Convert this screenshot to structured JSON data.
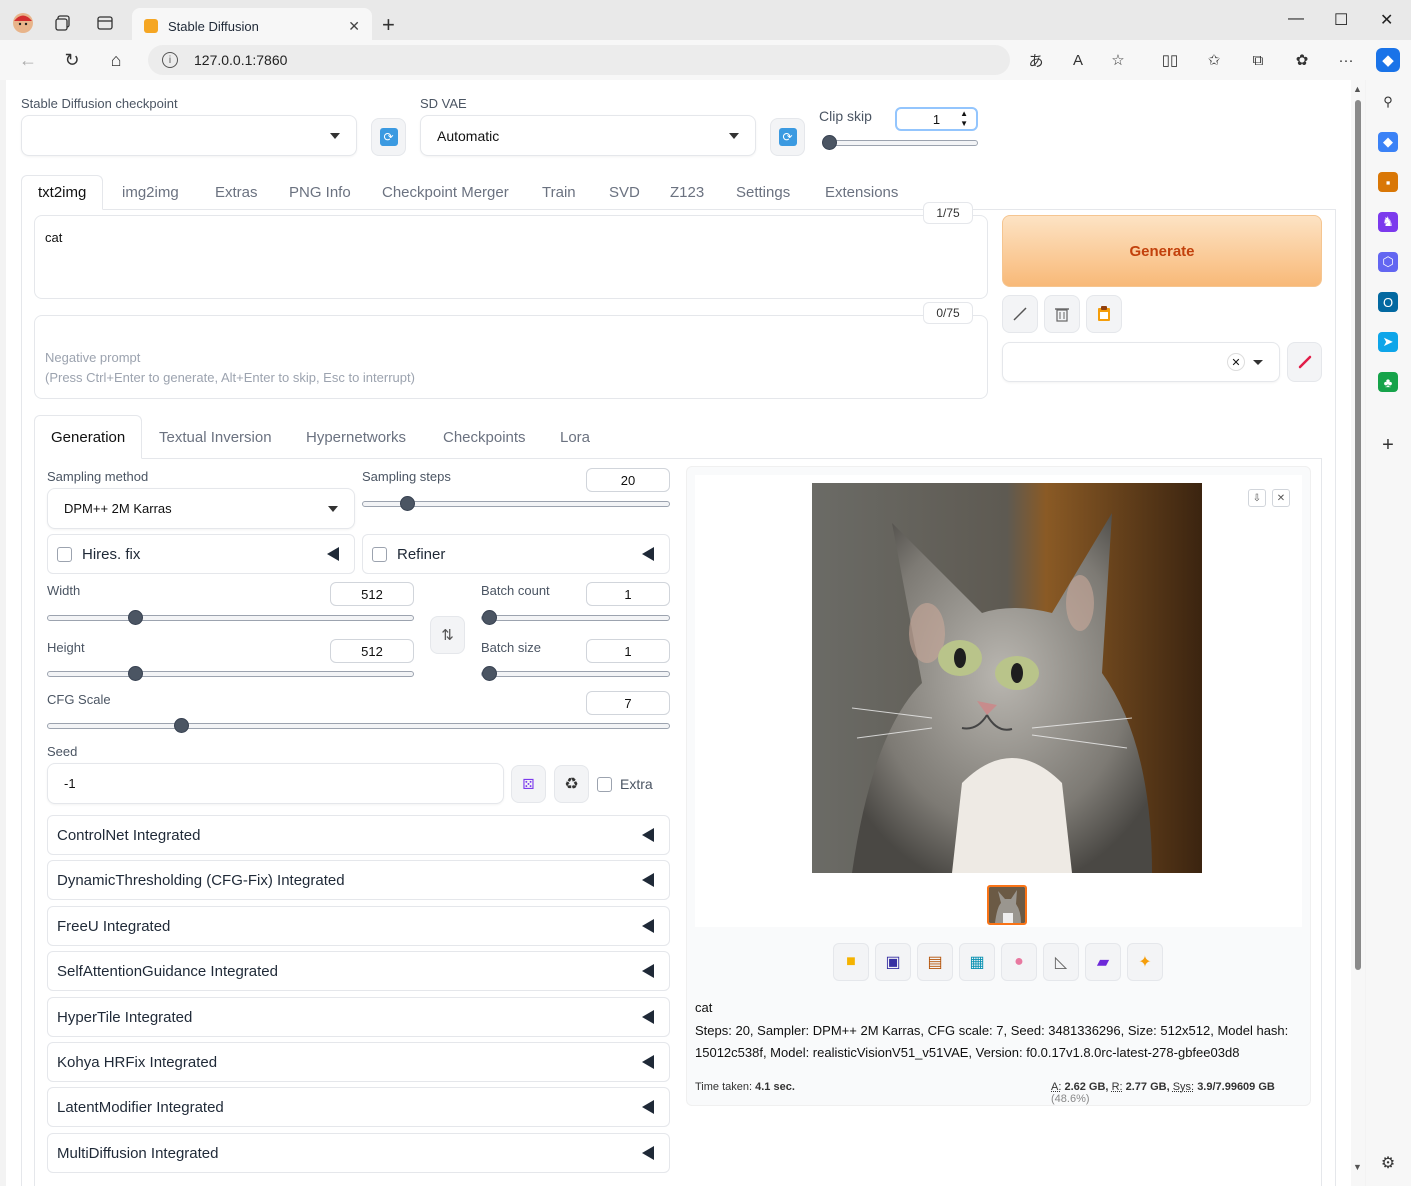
{
  "browser": {
    "tab_title": "Stable Diffusion",
    "url": "127.0.0.1:7860"
  },
  "top": {
    "checkpoint_label": "Stable Diffusion checkpoint",
    "checkpoint_value": "",
    "vae_label": "SD VAE",
    "vae_value": "Automatic",
    "clipskip_label": "Clip skip",
    "clipskip_value": "1",
    "clipskip_level": 1
  },
  "main_tabs": [
    "txt2img",
    "img2img",
    "Extras",
    "PNG Info",
    "Checkpoint Merger",
    "Train",
    "SVD",
    "Z123",
    "Settings",
    "Extensions"
  ],
  "prompt": {
    "text": "cat",
    "token_count": "1/75",
    "negative_placeholder": "Negative prompt\n(Press Ctrl+Enter to generate, Alt+Enter to skip, Esc to interrupt)",
    "negative_token_count": "0/75"
  },
  "generate_label": "Generate",
  "sub_tabs": [
    "Generation",
    "Textual Inversion",
    "Hypernetworks",
    "Checkpoints",
    "Lora"
  ],
  "generation": {
    "sampling_method_label": "Sampling method",
    "sampling_method_value": "DPM++ 2M Karras",
    "sampling_steps_label": "Sampling steps",
    "sampling_steps_value": "20",
    "hires_label": "Hires. fix",
    "refiner_label": "Refiner",
    "width_label": "Width",
    "width_value": "512",
    "height_label": "Height",
    "height_value": "512",
    "batch_count_label": "Batch count",
    "batch_count_value": "1",
    "batch_size_label": "Batch size",
    "batch_size_value": "1",
    "cfg_label": "CFG Scale",
    "cfg_value": "7",
    "seed_label": "Seed",
    "seed_value": "-1",
    "extra_label": "Extra"
  },
  "accordions": [
    "ControlNet Integrated",
    "DynamicThresholding (CFG-Fix) Integrated",
    "FreeU Integrated",
    "SelfAttentionGuidance Integrated",
    "HyperTile Integrated",
    "Kohya HRFix Integrated",
    "LatentModifier Integrated",
    "MultiDiffusion Integrated"
  ],
  "output": {
    "prompt": "cat",
    "params_line1": "Steps: 20, Sampler: DPM++ 2M Karras, CFG scale: 7, Seed: 3481336296, Size: 512x512, Model hash:",
    "params_line2": "15012c538f, Model: realisticVisionV51_v51VAE, Version: f0.0.17v1.8.0rc-latest-278-gbfee03d8",
    "time_label": "Time taken:",
    "time_value": "4.1 sec.",
    "mem_a_label": "A:",
    "mem_a": "2.62 GB,",
    "mem_r_label": "R:",
    "mem_r": "2.77 GB,",
    "mem_sys_label": "Sys:",
    "mem_sys": "3.9/7.99609 GB",
    "mem_pct": "(48.6%)"
  }
}
